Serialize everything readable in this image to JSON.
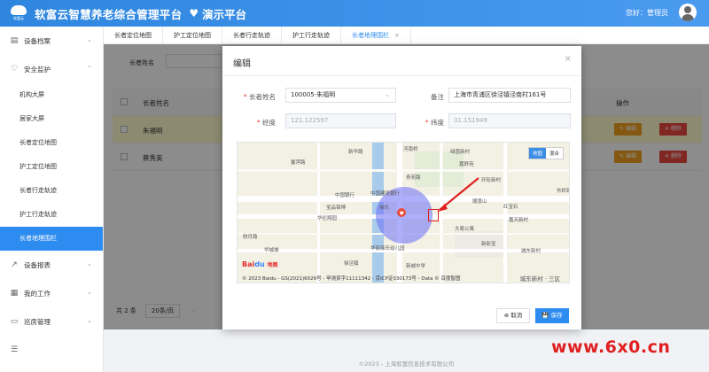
{
  "header": {
    "logo_text": "软富云",
    "title": "软富云智慧养老综合管理平台",
    "subtitle": "演示平台",
    "greeting": "您好：管理员"
  },
  "sidebar": {
    "groups": [
      {
        "label": "设备档案",
        "icon": "device-icon"
      },
      {
        "label": "安全监护",
        "icon": "heart-pulse-icon"
      }
    ],
    "items": [
      {
        "label": "机构大屏"
      },
      {
        "label": "居家大屏"
      },
      {
        "label": "长者定位地图"
      },
      {
        "label": "护工定位地图"
      },
      {
        "label": "长者行走轨迹"
      },
      {
        "label": "护工行走轨迹"
      },
      {
        "label": "长者地理围栏",
        "active": true
      }
    ],
    "bottom_groups": [
      {
        "label": "设备报表",
        "icon": "chart-icon"
      },
      {
        "label": "我的工作",
        "icon": "calendar-icon"
      },
      {
        "label": "巡房管理",
        "icon": "bed-icon"
      },
      {
        "label": "",
        "icon": "list-icon"
      }
    ]
  },
  "tabs": [
    {
      "label": "长者定位地图"
    },
    {
      "label": "护工定位地图"
    },
    {
      "label": "长者行走轨迹"
    },
    {
      "label": "护工行走轨迹"
    },
    {
      "label": "长者地理围栏",
      "active": true,
      "close": "×"
    }
  ],
  "main": {
    "filter_label": "长者姓名",
    "table": {
      "headers": [
        "长者姓名",
        "操作"
      ],
      "rows": [
        {
          "name": "朱福明"
        },
        {
          "name": "蔡秀英"
        }
      ],
      "edit_label": "编辑",
      "delete_label": "删除"
    },
    "pager": {
      "total": "共 2 条",
      "size": "20条/页"
    }
  },
  "modal": {
    "title": "编辑",
    "close": "×",
    "fields": {
      "elder_label": "长者姓名",
      "elder_value": "100005-朱福明",
      "note_label": "备注",
      "note_value": "上海市青浦区徐泾镇泾南村161号",
      "lng_label": "经度",
      "lng_placeholder": "121.122597",
      "lat_label": "纬度",
      "lat_placeholder": "31.151949"
    },
    "map": {
      "type_map": "地图",
      "type_hybrid": "混合",
      "logo_bai": "Bai",
      "logo_du": "du",
      "logo_cn": "地图",
      "copyright": "© 2023 Baidu - GS(2021)6026号 - 甲测资字11111342 - 京ICP证030173号 - Data © 百度智图",
      "scale": "城东新村 · 三区",
      "labels": [
        "河南桥",
        "馨萍路",
        "青苑路",
        "嘉舒苑",
        "中国银行",
        "中国建设银行",
        "宝品锦博",
        "徐乐",
        "华伦翔园",
        "环轮新村",
        "红宝石",
        "顺景山",
        "嘉天新村",
        "大易公寓",
        "新影宝",
        "新城中学",
        "华城城",
        "财月路",
        "城东新村",
        "绿茵新村",
        "华丽菲乐幼儿园",
        "东岭路",
        "新华路",
        "徐泾镇"
      ]
    },
    "cancel_label": "取消",
    "save_label": "保存"
  },
  "footer": {
    "text": "©2023 - 上海软富信息技术有限公司"
  },
  "watermark": "www.6x0.cn",
  "colors": {
    "primary": "#2d8cf0",
    "warning": "#f0a020",
    "danger": "#e9473c",
    "fence": "#6a6ef5"
  }
}
